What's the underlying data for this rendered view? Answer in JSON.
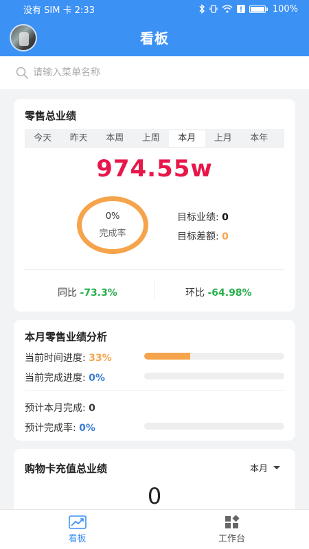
{
  "status": {
    "left_text": "没有 SIM 卡 2:33",
    "battery": "100%"
  },
  "header": {
    "title": "看板"
  },
  "search": {
    "placeholder": "请输入菜单名称"
  },
  "retail": {
    "title": "零售总业绩",
    "tabs": [
      "今天",
      "昨天",
      "本周",
      "上周",
      "本月",
      "上月",
      "本年"
    ],
    "active_tab": "本月",
    "total": "974.55w",
    "completion_pct": "0%",
    "completion_label": "完成率",
    "target_label": "目标业绩:",
    "target_value": "0",
    "gap_label": "目标差额:",
    "gap_value": "0",
    "yoy_label": "同比",
    "yoy_value": "-73.3%",
    "mom_label": "环比",
    "mom_value": "-64.98%"
  },
  "analysis": {
    "title": "本月零售业绩分析",
    "time_progress_label": "当前时间进度:",
    "time_progress_value": "33%",
    "time_progress_fraction": 0.33,
    "completion_progress_label": "当前完成进度:",
    "completion_progress_value": "0%",
    "completion_progress_fraction": 0,
    "forecast_label": "预计本月完成:",
    "forecast_value": "0",
    "forecast_rate_label": "预计完成率:",
    "forecast_rate_value": "0%",
    "forecast_rate_fraction": 0
  },
  "card_recharge": {
    "title": "购物卡充值总业绩",
    "period": "本月",
    "value": "0"
  },
  "nav": {
    "dashboard": "看板",
    "workbench": "工作台"
  },
  "colors": {
    "brand": "#3c91f5",
    "accent_red": "#e8174a",
    "orange": "#f6a44c",
    "green": "#27b04b",
    "blue": "#3a7bd5"
  }
}
